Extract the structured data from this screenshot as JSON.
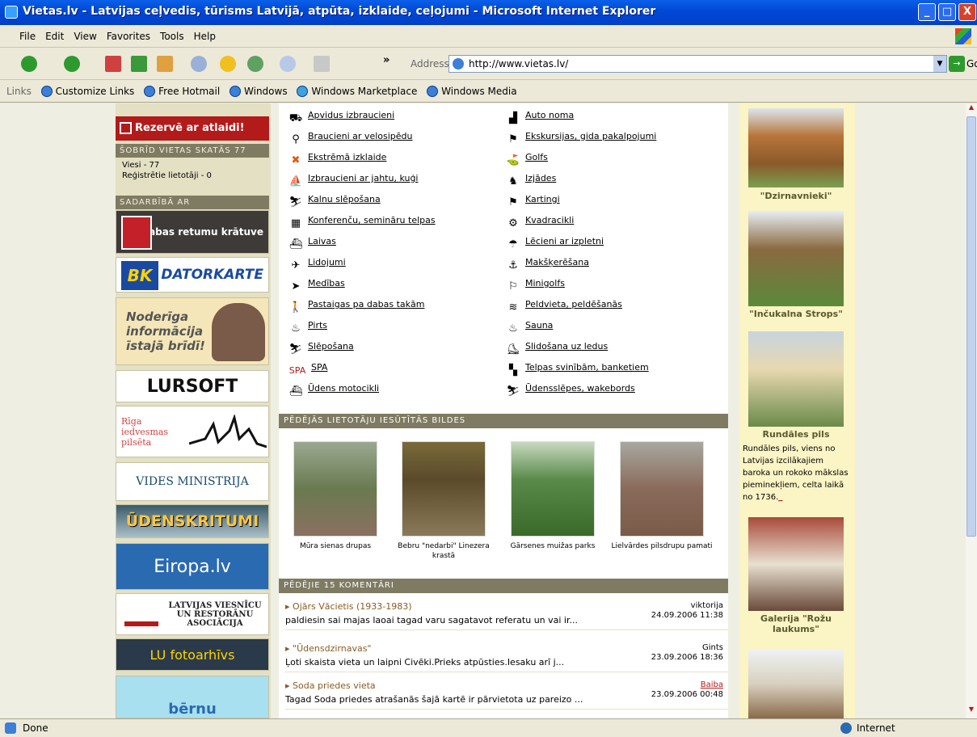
{
  "window": {
    "title": "Vietas.lv - Latvijas ceļvedis, tūrisms Latvijā, atpūta, izklaide, ceļojumi - Microsoft Internet Explorer",
    "min": "_",
    "max": "□",
    "close": "X"
  },
  "menu": [
    "File",
    "Edit",
    "View",
    "Favorites",
    "Tools",
    "Help"
  ],
  "toolbar": {
    "address_label": "Address",
    "url": "http://www.vietas.lv/",
    "go": "Go",
    "chevron": "»"
  },
  "links": {
    "label": "Links",
    "items": [
      "Customize Links",
      "Free Hotmail",
      "Windows",
      "Windows Marketplace",
      "Windows Media"
    ]
  },
  "left": {
    "reserve": "Rezervē ar atlaidi!",
    "now_viewing": "ŠOBRĪD VIETAS SKATĀS 77",
    "guests": "Viesi - 77",
    "registered": "Reģistrētie lietotāji - 0",
    "partners_header": "SADARBĪBĀ AR",
    "banners": [
      "Dabas retumu krātuve",
      "DATORKARTE",
      "Noderīga informācija īstajā brīdī!",
      "LURSOFT",
      "Rīga iedvesmas pilsēta",
      "VIDES MINISTRIJA",
      "ŪDENSKRITUMI",
      "Eiropa.lv",
      "LATVIJAS VIESNĪCU UN RESTORĀNU ASOCIĀCIJA",
      "LU fotoarhīvs",
      "bērnu"
    ]
  },
  "activities": {
    "left": [
      "Apvidus izbraucieni",
      "Braucieni ar velosipēdu",
      "Ekstrēmā izklaide",
      "Izbraucieni ar jahtu, kuģi",
      "Kalnu slēpošana",
      "Konferenču, semināru telpas",
      "Laivas",
      "Lidojumi",
      "Medības",
      "Pastaigas pa dabas takām",
      "Pirts",
      "Slēpošana",
      "SPA",
      "Ūdens motocikli"
    ],
    "right": [
      "Auto noma",
      "Ekskursijas, gida pakalpojumi",
      "Golfs",
      "Izjādes",
      "Kartingi",
      "Kvadracikli",
      "Lēcieni ar izpletni",
      "Makšķerēšana",
      "Minigolfs",
      "Peldvieta, peldēšanās",
      "Sauna",
      "Slidošana uz ledus",
      "Telpas svinībām, banketiem",
      "Ūdensslēpes, wakebords"
    ]
  },
  "photos": {
    "header": "PĒDĒJĀS LIETOTĀJU IESŪTĪTĀS BILDES",
    "items": [
      "Mūra sienas drupas",
      "Bebru \"nedarbi\" Linezera krastā",
      "Gārsenes muižas parks",
      "Lielvārdes pilsdrupu pamati"
    ]
  },
  "comments": {
    "header": "PĒDĒJIE 15 KOMENTĀRI",
    "items": [
      {
        "title": "Ojārs Vācietis (1933-1983)",
        "text": "paldiesin sai majas laoai tagad varu sagatavot referatu un vai ir...",
        "user": "viktorija",
        "date": "24.09.2006 11:38"
      },
      {
        "title": "\"Ūdensdzirnavas\"",
        "text": "Ļoti skaista vieta un laipni Civēki.Prieks atpūsties.Iesaku arī j...",
        "user": "Gints",
        "date": "23.09.2006 18:36"
      },
      {
        "title": "Soda priedes vieta",
        "text": "Tagad Soda priedes atrašanās šajā kartē ir pārvietota uz pareizo ...",
        "user": "Baiba",
        "date": "23.09.2006 00:48"
      }
    ]
  },
  "right": {
    "captions": [
      "\"Dzirnavnieki\"",
      "\"Inčukalna Strops\"",
      "Rundāles pils",
      "Galerija \"Rožu laukums\""
    ],
    "rundale_text": "Rundāles pils, viens no Latvijas izcilākajiem baroka un rokoko mākslas pieminekļiem, celta laikā no 1736.",
    "rundale_more": "_"
  },
  "status": {
    "left": "Done",
    "zone": "Internet"
  },
  "colors": {
    "title_blue": "#0048d6",
    "brand_red": "#b31a1a",
    "section_olive": "#7e7b62",
    "right_yellow": "#fbf4c4"
  }
}
